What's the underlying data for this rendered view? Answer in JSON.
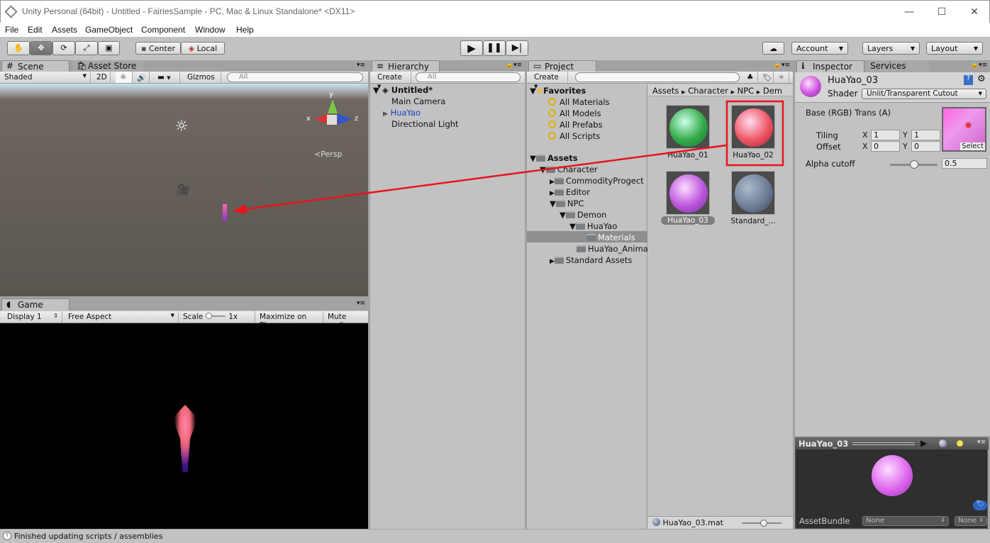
{
  "window": {
    "title": "Unity Personal (64bit) - Untitled - FairiesSample - PC, Mac & Linux Standalone* <DX11>",
    "minimize": "—",
    "maximize": "☐",
    "close": "✕"
  },
  "menu": [
    "File",
    "Edit",
    "Assets",
    "GameObject",
    "Component",
    "Window",
    "Help"
  ],
  "toolbar": {
    "tools": [
      "hand-icon",
      "move-icon",
      "rotate-icon",
      "scale-icon",
      "rect-icon"
    ],
    "pivot": "Center",
    "space": "Local",
    "account": "Account",
    "layers": "Layers",
    "layout": "Layout"
  },
  "scene": {
    "tab": "Scene",
    "tab2": "Asset Store",
    "shading": "Shaded",
    "mode2d": "2D",
    "gizmos": "Gizmos",
    "search_placeholder": "All",
    "persp": "<Persp",
    "axis_x": "x",
    "axis_y": "y",
    "axis_z": "z"
  },
  "game": {
    "tab": "Game",
    "display": "Display 1",
    "aspect": "Free Aspect",
    "scale_label": "Scale",
    "scale_value": "1x",
    "maximize": "Maximize on Play",
    "mute": "Mute audio"
  },
  "hierarchy": {
    "tab": "Hierarchy",
    "create": "Create",
    "search_placeholder": "All",
    "scene": "Untitled*",
    "items": [
      "Main Camera",
      "HuaYao",
      "Directional Light"
    ]
  },
  "project": {
    "tab": "Project",
    "create": "Create",
    "favorites": "Favorites",
    "fav_items": [
      "All Materials",
      "All Models",
      "All Prefabs",
      "All Scripts"
    ],
    "assets": "Assets",
    "tree": [
      "Character",
      "CommodityProgect",
      "Editor",
      "NPC",
      "Demon",
      "HuaYao",
      "Materials",
      "HuaYao_Anima",
      "Standard Assets"
    ],
    "breadcrumb": [
      "Assets",
      "Character",
      "NPC",
      "Dem"
    ],
    "grid": [
      "HuaYao_01",
      "HuaYao_02",
      "HuaYao_03",
      "Standard_..."
    ],
    "selected_file": "HuaYao_03.mat"
  },
  "inspector": {
    "tab": "Inspector",
    "tab2": "Services",
    "name": "HuaYao_03",
    "shader_label": "Shader",
    "shader": "Unlit/Transparent Cutout",
    "base": "Base (RGB) Trans (A)",
    "tiling": "Tiling",
    "offset": "Offset",
    "x": "X",
    "y": "Y",
    "tiling_x": "1",
    "tiling_y": "1",
    "offset_x": "0",
    "offset_y": "0",
    "select": "Select",
    "alpha_label": "Alpha cutoff",
    "alpha": "0.5",
    "alpha_fraction": 0.5
  },
  "preview": {
    "title": "HuaYao_03",
    "assetbundle": "AssetBundle",
    "bundle": "None",
    "variant": "None"
  },
  "status": "Finished updating scripts / assemblies",
  "colors": {
    "annotation": "#e8141c",
    "selection": "#8e8e8e",
    "link": "#1a3fbf"
  }
}
